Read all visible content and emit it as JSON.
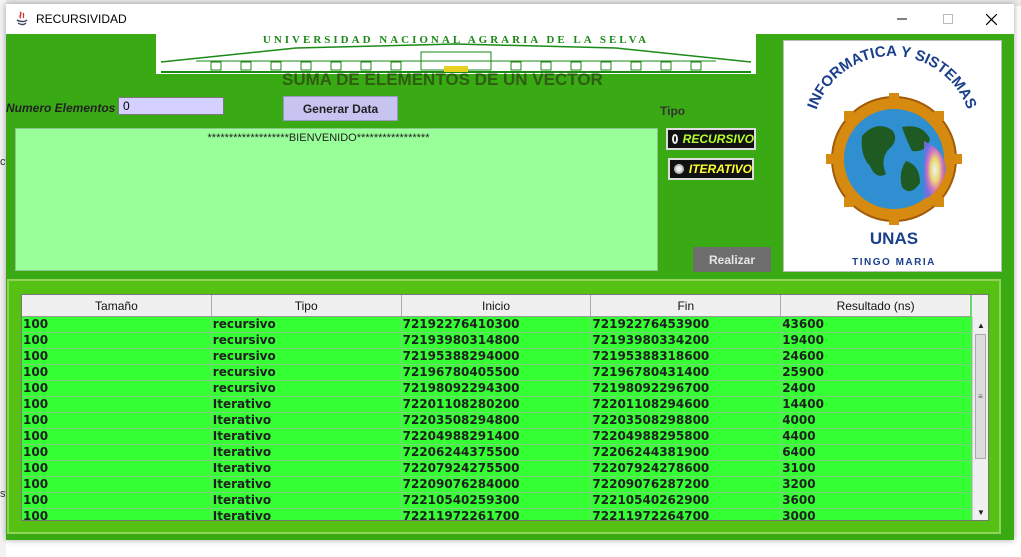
{
  "window": {
    "title": "RECURSIVIDAD",
    "minimize_icon": "minimize-icon",
    "maximize_icon": "maximize-icon",
    "close_icon": "close-icon"
  },
  "background": {
    "left_fragments": [
      "ct",
      "sv"
    ]
  },
  "banner": {
    "university": "UNIVERSIDAD NACIONAL AGRARIA DE LA SELVA"
  },
  "main": {
    "subtitle": "SUMA DE ELEMENTOS DE UN VECTOR",
    "num_label": "Numero Elementos",
    "num_value": "0",
    "generate_label": "Generar Data",
    "tipo_label": "Tipo",
    "output_text": "*******************BIENVENIDO*****************",
    "radio_recursivo": "RECURSIVO",
    "radio_iterativo": "ITERATIVO",
    "realizar_label": "Realizar"
  },
  "logo": {
    "top_text": "INFORMATICA Y SISTEMAS",
    "unas": "UNAS",
    "city": "TINGO MARIA"
  },
  "colors": {
    "window_bg": "#3aaa14",
    "textarea_bg": "#99ff99",
    "table_row_bg": "#33ff33",
    "radio_recursivo_text": "#b6ff2e",
    "radio_iterativo_text": "#ffff33",
    "button_bg": "#c8c4f2"
  },
  "table": {
    "headers": [
      "Tamaño",
      "Tipo",
      "Inicio",
      "Fin",
      "Resultado (ns)"
    ],
    "rows": [
      [
        "100",
        "recursivo",
        "72192276410300",
        "72192276453900",
        "43600"
      ],
      [
        "100",
        "recursivo",
        "72193980314800",
        "72193980334200",
        "19400"
      ],
      [
        "100",
        "recursivo",
        "72195388294000",
        "72195388318600",
        "24600"
      ],
      [
        "100",
        "recursivo",
        "72196780405500",
        "72196780431400",
        "25900"
      ],
      [
        "100",
        "recursivo",
        "72198092294300",
        "72198092296700",
        "2400"
      ],
      [
        "100",
        "Iterativo",
        "72201108280200",
        "72201108294600",
        "14400"
      ],
      [
        "100",
        "Iterativo",
        "72203508294800",
        "72203508298800",
        "4000"
      ],
      [
        "100",
        "Iterativo",
        "72204988291400",
        "72204988295800",
        "4400"
      ],
      [
        "100",
        "Iterativo",
        "72206244375500",
        "72206244381900",
        "6400"
      ],
      [
        "100",
        "Iterativo",
        "72207924275500",
        "72207924278600",
        "3100"
      ],
      [
        "100",
        "Iterativo",
        "72209076284000",
        "72209076287200",
        "3200"
      ],
      [
        "100",
        "Iterativo",
        "72210540259300",
        "72210540262900",
        "3600"
      ],
      [
        "100",
        "Iterativo",
        "72211972261700",
        "72211972264700",
        "3000"
      ]
    ]
  }
}
